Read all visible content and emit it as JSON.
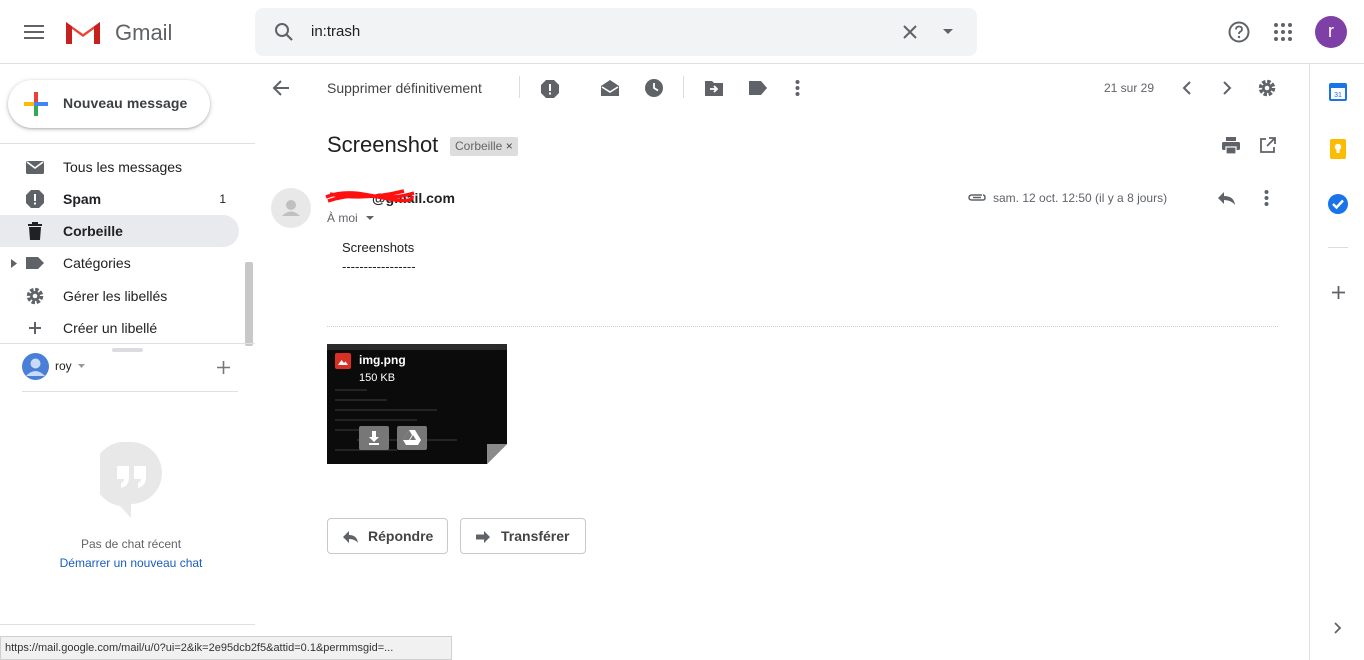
{
  "app": {
    "brand": "Gmail"
  },
  "search": {
    "value": "in:trash"
  },
  "user": {
    "initial": "r",
    "name": "roy"
  },
  "compose": {
    "label": "Nouveau message"
  },
  "sidebar": {
    "items": [
      {
        "label": "Tous les messages",
        "icon": "all-mail-icon",
        "count": ""
      },
      {
        "label": "Spam",
        "icon": "spam-icon",
        "count": "1"
      },
      {
        "label": "Corbeille",
        "icon": "trash-icon",
        "count": ""
      },
      {
        "label": "Catégories",
        "icon": "label-icon",
        "count": ""
      },
      {
        "label": "Gérer les libellés",
        "icon": "gear-icon",
        "count": ""
      },
      {
        "label": "Créer un libellé",
        "icon": "plus-icon",
        "count": ""
      }
    ]
  },
  "toolbar": {
    "delete_forever": "Supprimer définitivement",
    "pager": "21 sur 29"
  },
  "message": {
    "subject": "Screenshot",
    "label_chip": "Corbeille",
    "sender": "@gmail.com",
    "recipient": "À moi",
    "date": "sam. 12 oct. 12:50 (il y a 8 jours)",
    "body_line1": "Screenshots",
    "body_line2": "-----------------",
    "attachment": {
      "name": "img.png",
      "size": "150 KB"
    },
    "reply_label": "Répondre",
    "forward_label": "Transférer"
  },
  "chat": {
    "empty_text": "Pas de chat récent",
    "start_link": "Démarrer un nouveau chat"
  },
  "status_bar": {
    "url": "https://mail.google.com/mail/u/0?ui=2&ik=2e95dcb2f5&attid=0.1&permmsgid=..."
  },
  "colors": {
    "accent": "#1a73e8",
    "avatar": "#7e3fa6",
    "gmail_red": "#ea4335"
  }
}
